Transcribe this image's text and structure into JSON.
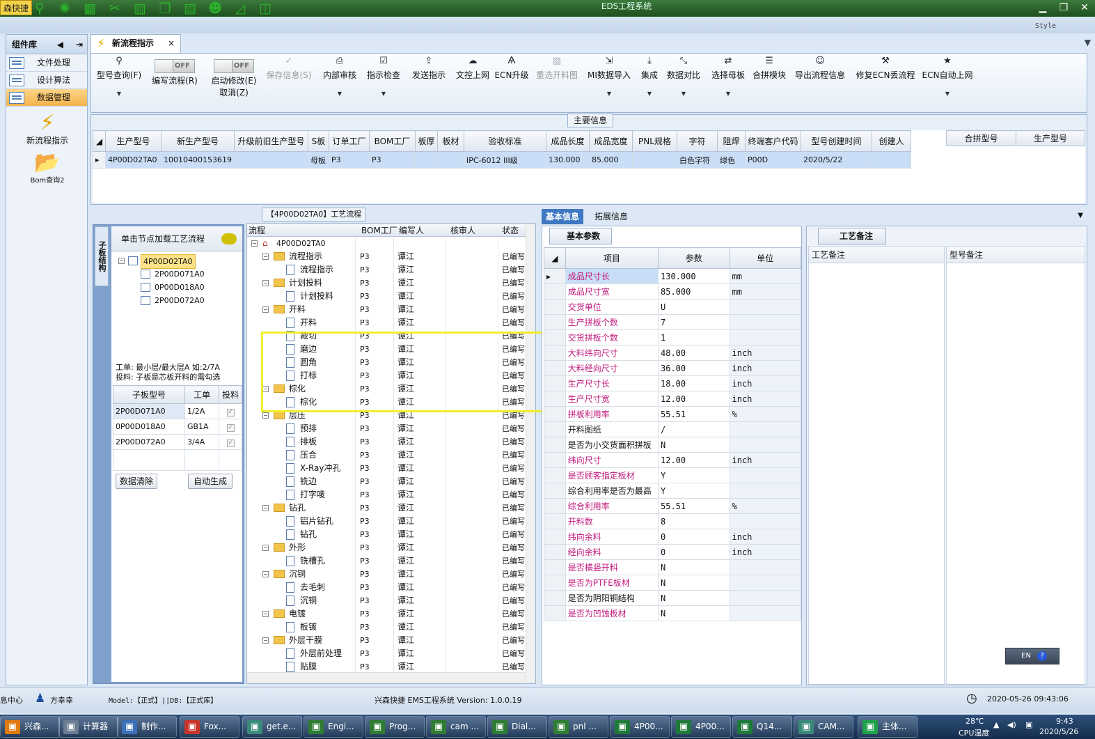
{
  "titlebar": {
    "brand": "森快捷",
    "title": "EDS工程系统",
    "style": "Style"
  },
  "nav": {
    "header": "组件库",
    "items": [
      {
        "label": "文件处理"
      },
      {
        "label": "设计算法"
      },
      {
        "label": "数据管理"
      }
    ],
    "tools": [
      {
        "label": "新流程指示"
      },
      {
        "label": "Bom查询2"
      }
    ]
  },
  "doc_tab": {
    "label": "新流程指示"
  },
  "toolbar": {
    "buttons": [
      {
        "label": "型号查询(F)",
        "icon": "search-icon",
        "dd": true,
        "disabled": false
      },
      {
        "label": "编写流程(R)",
        "toggle": "OFF"
      },
      {
        "label": "启动修改(E)",
        "label2": "取消(Z)",
        "toggle": "OFF"
      },
      {
        "label": "保存信息(S)",
        "icon": "check-icon",
        "disabled": true
      },
      {
        "label": "内部审核",
        "icon": "print-icon",
        "dd": true
      },
      {
        "label": "指示检查",
        "icon": "checkbox-icon",
        "dd": true
      },
      {
        "label": "发送指示",
        "icon": "upload-icon"
      },
      {
        "label": "文控上网",
        "icon": "cloud-icon"
      },
      {
        "label": "ECN升级",
        "icon": "ecn-icon"
      },
      {
        "label": "重选开料图",
        "icon": "image-icon",
        "disabled": true
      },
      {
        "label": "MI数据导入",
        "icon": "import-icon",
        "dd": true
      },
      {
        "label": "集成",
        "icon": "download-icon",
        "dd": true
      },
      {
        "label": "数据对比",
        "icon": "compare-icon",
        "dd": true
      },
      {
        "label": "选择母板",
        "icon": "shuffle-icon",
        "dd": true
      },
      {
        "label": "合拼模块",
        "icon": "list-icon"
      },
      {
        "label": "导出流程信息",
        "icon": "smile-icon"
      },
      {
        "label": "修复ECN丢流程",
        "icon": "wrench-icon"
      },
      {
        "label": "ECN自动上网",
        "icon": "star-icon",
        "dd": true
      }
    ]
  },
  "main_info": {
    "caption": "主要信息",
    "columns": [
      "生产型号",
      "新生产型号",
      "升级前旧生产型号",
      "S板",
      "订单工厂",
      "BOM工厂",
      "板厚",
      "板材",
      "验收标准",
      "成品长度",
      "成品宽度",
      "PNL规格",
      "字符",
      "阻焊",
      "终端客户代码",
      "型号创建时间",
      "创建人"
    ],
    "rows": [
      [
        "4P00D02TA0",
        "10010400153619",
        "",
        "母板",
        "P3",
        "P3",
        "",
        "",
        "IPC-6012 III级",
        "130.000",
        "85.000",
        "",
        "白色字符",
        "绿色",
        "P00D",
        "2020/5/22",
        ""
      ]
    ],
    "side_columns": [
      "合拼型号",
      "生产型号"
    ]
  },
  "struct_panel": {
    "vtab": "子板结构",
    "hint": "单击节点加载工艺流程",
    "tree": {
      "root": "4P00D02TA0",
      "children": [
        "2P00D071A0",
        "0P00D018A0",
        "2P00D072A0"
      ]
    },
    "note1": "工单: 最小层/最大层A 如:2/7A",
    "note2": "投料: 子板是芯板开料的需勾选",
    "sub_columns": [
      "子板型号",
      "工单",
      "投料"
    ],
    "sub_rows": [
      [
        "2P00D071A0",
        "1/2A"
      ],
      [
        "0P00D018A0",
        "GB1A"
      ],
      [
        "2P00D072A0",
        "3/4A"
      ]
    ],
    "btn_clear": "数据清除",
    "btn_auto": "自动生成"
  },
  "process": {
    "tab": "【4P00D02TA0】工艺流程",
    "columns": [
      "流程",
      "BOM工厂",
      "编写人",
      "核审人",
      "状态"
    ],
    "root": "4P00D02TA0",
    "rows": [
      {
        "lvl": 1,
        "name": "流程指示",
        "bom": "P3",
        "writer": "谭江",
        "status": "已编写"
      },
      {
        "lvl": 2,
        "name": "流程指示",
        "bom": "P3",
        "writer": "谭江",
        "status": "已编写"
      },
      {
        "lvl": 1,
        "name": "计划投料",
        "bom": "P3",
        "writer": "谭江",
        "status": "已编写"
      },
      {
        "lvl": 2,
        "name": "计划投料",
        "bom": "P3",
        "writer": "谭江",
        "status": "已编写"
      },
      {
        "lvl": 1,
        "name": "开料",
        "bom": "P3",
        "writer": "谭江",
        "status": "已编写"
      },
      {
        "lvl": 2,
        "name": "开料",
        "bom": "P3",
        "writer": "谭江",
        "status": "已编写"
      },
      {
        "lvl": 2,
        "name": "裁切",
        "bom": "P3",
        "writer": "谭江",
        "status": "已编写"
      },
      {
        "lvl": 2,
        "name": "磨边",
        "bom": "P3",
        "writer": "谭江",
        "status": "已编写"
      },
      {
        "lvl": 2,
        "name": "圆角",
        "bom": "P3",
        "writer": "谭江",
        "status": "已编写"
      },
      {
        "lvl": 2,
        "name": "打标",
        "bom": "P3",
        "writer": "谭江",
        "status": "已编写"
      },
      {
        "lvl": 1,
        "name": "棕化",
        "bom": "P3",
        "writer": "谭江",
        "status": "已编写"
      },
      {
        "lvl": 2,
        "name": "棕化",
        "bom": "P3",
        "writer": "谭江",
        "status": "已编写"
      },
      {
        "lvl": 1,
        "name": "层压",
        "bom": "P3",
        "writer": "谭江",
        "status": "已编写"
      },
      {
        "lvl": 2,
        "name": "预排",
        "bom": "P3",
        "writer": "谭江",
        "status": "已编写"
      },
      {
        "lvl": 2,
        "name": "排板",
        "bom": "P3",
        "writer": "谭江",
        "status": "已编写"
      },
      {
        "lvl": 2,
        "name": "压合",
        "bom": "P3",
        "writer": "谭江",
        "status": "已编写"
      },
      {
        "lvl": 2,
        "name": "X-Ray冲孔",
        "bom": "P3",
        "writer": "谭江",
        "status": "已编写"
      },
      {
        "lvl": 2,
        "name": "铣边",
        "bom": "P3",
        "writer": "谭江",
        "status": "已编写"
      },
      {
        "lvl": 2,
        "name": "打字唛",
        "bom": "P3",
        "writer": "谭江",
        "status": "已编写"
      },
      {
        "lvl": 1,
        "name": "钻孔",
        "bom": "P3",
        "writer": "谭江",
        "status": "已编写"
      },
      {
        "lvl": 2,
        "name": "铝片钻孔",
        "bom": "P3",
        "writer": "谭江",
        "status": "已编写"
      },
      {
        "lvl": 2,
        "name": "钻孔",
        "bom": "P3",
        "writer": "谭江",
        "status": "已编写"
      },
      {
        "lvl": 1,
        "name": "外形",
        "bom": "P3",
        "writer": "谭江",
        "status": "已编写"
      },
      {
        "lvl": 2,
        "name": "铣槽孔",
        "bom": "P3",
        "writer": "谭江",
        "status": "已编写"
      },
      {
        "lvl": 1,
        "name": "沉铜",
        "bom": "P3",
        "writer": "谭江",
        "status": "已编写"
      },
      {
        "lvl": 2,
        "name": "去毛刺",
        "bom": "P3",
        "writer": "谭江",
        "status": "已编写"
      },
      {
        "lvl": 2,
        "name": "沉铜",
        "bom": "P3",
        "writer": "谭江",
        "status": "已编写"
      },
      {
        "lvl": 1,
        "name": "电镀",
        "bom": "P3",
        "writer": "谭江",
        "status": "已编写"
      },
      {
        "lvl": 2,
        "name": "板镀",
        "bom": "P3",
        "writer": "谭江",
        "status": "已编写"
      },
      {
        "lvl": 1,
        "name": "外层干膜",
        "bom": "P3",
        "writer": "谭江",
        "status": "已编写"
      },
      {
        "lvl": 2,
        "name": "外层前处理",
        "bom": "P3",
        "writer": "谭江",
        "status": "已编写"
      },
      {
        "lvl": 2,
        "name": "贴膜",
        "bom": "P3",
        "writer": "谭江",
        "status": "已编写"
      }
    ]
  },
  "right": {
    "tab_basic": "基本信息",
    "tab_ext": "拓展信息",
    "basic_tab": "基本参数",
    "param_columns": [
      "项目",
      "参数",
      "单位"
    ],
    "params": [
      {
        "item": "成品尺寸长",
        "val": "130.000",
        "unit": "mm",
        "mag": true
      },
      {
        "item": "成品尺寸宽",
        "val": "85.000",
        "unit": "mm",
        "mag": true
      },
      {
        "item": "交货单位",
        "val": "U",
        "unit": "",
        "mag": true
      },
      {
        "item": "生产拼板个数",
        "val": "7",
        "unit": "",
        "mag": true
      },
      {
        "item": "交货拼板个数",
        "val": "1",
        "unit": "",
        "mag": true
      },
      {
        "item": "大料纬向尺寸",
        "val": "48.00",
        "unit": "inch",
        "mag": true
      },
      {
        "item": "大料经向尺寸",
        "val": "36.00",
        "unit": "inch",
        "mag": true
      },
      {
        "item": "生产尺寸长",
        "val": "18.00",
        "unit": "inch",
        "mag": true
      },
      {
        "item": "生产尺寸宽",
        "val": "12.00",
        "unit": "inch",
        "mag": true
      },
      {
        "item": "拼板利用率",
        "val": "55.51",
        "unit": "%",
        "mag": true
      },
      {
        "item": "开料图纸",
        "val": "/",
        "unit": "",
        "mag": false
      },
      {
        "item": "是否为小交货面积拼板",
        "val": "N",
        "unit": "",
        "mag": false
      },
      {
        "item": "纬向尺寸",
        "val": "12.00",
        "unit": "inch",
        "mag": true
      },
      {
        "item": "是否顾客指定板材",
        "val": "Y",
        "unit": "",
        "mag": true
      },
      {
        "item": "综合利用率是否为最高",
        "val": "Y",
        "unit": "",
        "mag": false
      },
      {
        "item": "综合利用率",
        "val": "55.51",
        "unit": "%",
        "mag": true
      },
      {
        "item": "开料数",
        "val": "8",
        "unit": "",
        "mag": true
      },
      {
        "item": "纬向余料",
        "val": "0",
        "unit": "inch",
        "mag": true
      },
      {
        "item": "经向余料",
        "val": "0",
        "unit": "inch",
        "mag": true
      },
      {
        "item": "是否横竖开料",
        "val": "N",
        "unit": "",
        "mag": true
      },
      {
        "item": "是否为PTFE板材",
        "val": "N",
        "unit": "",
        "mag": true
      },
      {
        "item": "是否为阴阳铜结构",
        "val": "N",
        "unit": "",
        "mag": false
      },
      {
        "item": "是否为凹蚀板材",
        "val": "N",
        "unit": "",
        "mag": true
      }
    ],
    "craft_tab": "工艺备注",
    "craft_col1": "工艺备注",
    "craft_col2": "型号备注",
    "ime": "EN"
  },
  "status": {
    "left": "息中心",
    "user": "方幸幸",
    "model": "Model:【正式】||DB:【正式库】",
    "version": "兴森快捷 EMS工程系统 Version: 1.0.0.19",
    "datetime": "2020-05-26 09:43:06"
  },
  "taskbar": {
    "items": [
      {
        "label": "兴森...",
        "color": "#e07a10"
      },
      {
        "label": "计算器",
        "color": "#6b7c93"
      },
      {
        "label": "制作...",
        "color": "#3a70b8"
      },
      {
        "label": "Fox...",
        "color": "#c8342a"
      },
      {
        "label": "get.e...",
        "color": "#3a8a7a"
      },
      {
        "label": "Engi...",
        "color": "#2e7d32"
      },
      {
        "label": "Prog...",
        "color": "#2e7d32"
      },
      {
        "label": "cam ...",
        "color": "#2e7d32"
      },
      {
        "label": "Dial...",
        "color": "#2e7d32"
      },
      {
        "label": "pnl ...",
        "color": "#2e7d32"
      },
      {
        "label": "4P00...",
        "color": "#1f7a3a"
      },
      {
        "label": "4P00...",
        "color": "#1f7a3a"
      },
      {
        "label": "Q14...",
        "color": "#1f7a3a"
      },
      {
        "label": "CAM...",
        "color": "#3a8a7a"
      },
      {
        "label": "主体...",
        "color": "#1ea34a"
      }
    ],
    "temp": "28℃",
    "temp_label": "CPU温度",
    "time": "9:43",
    "date": "2020/5/26"
  }
}
